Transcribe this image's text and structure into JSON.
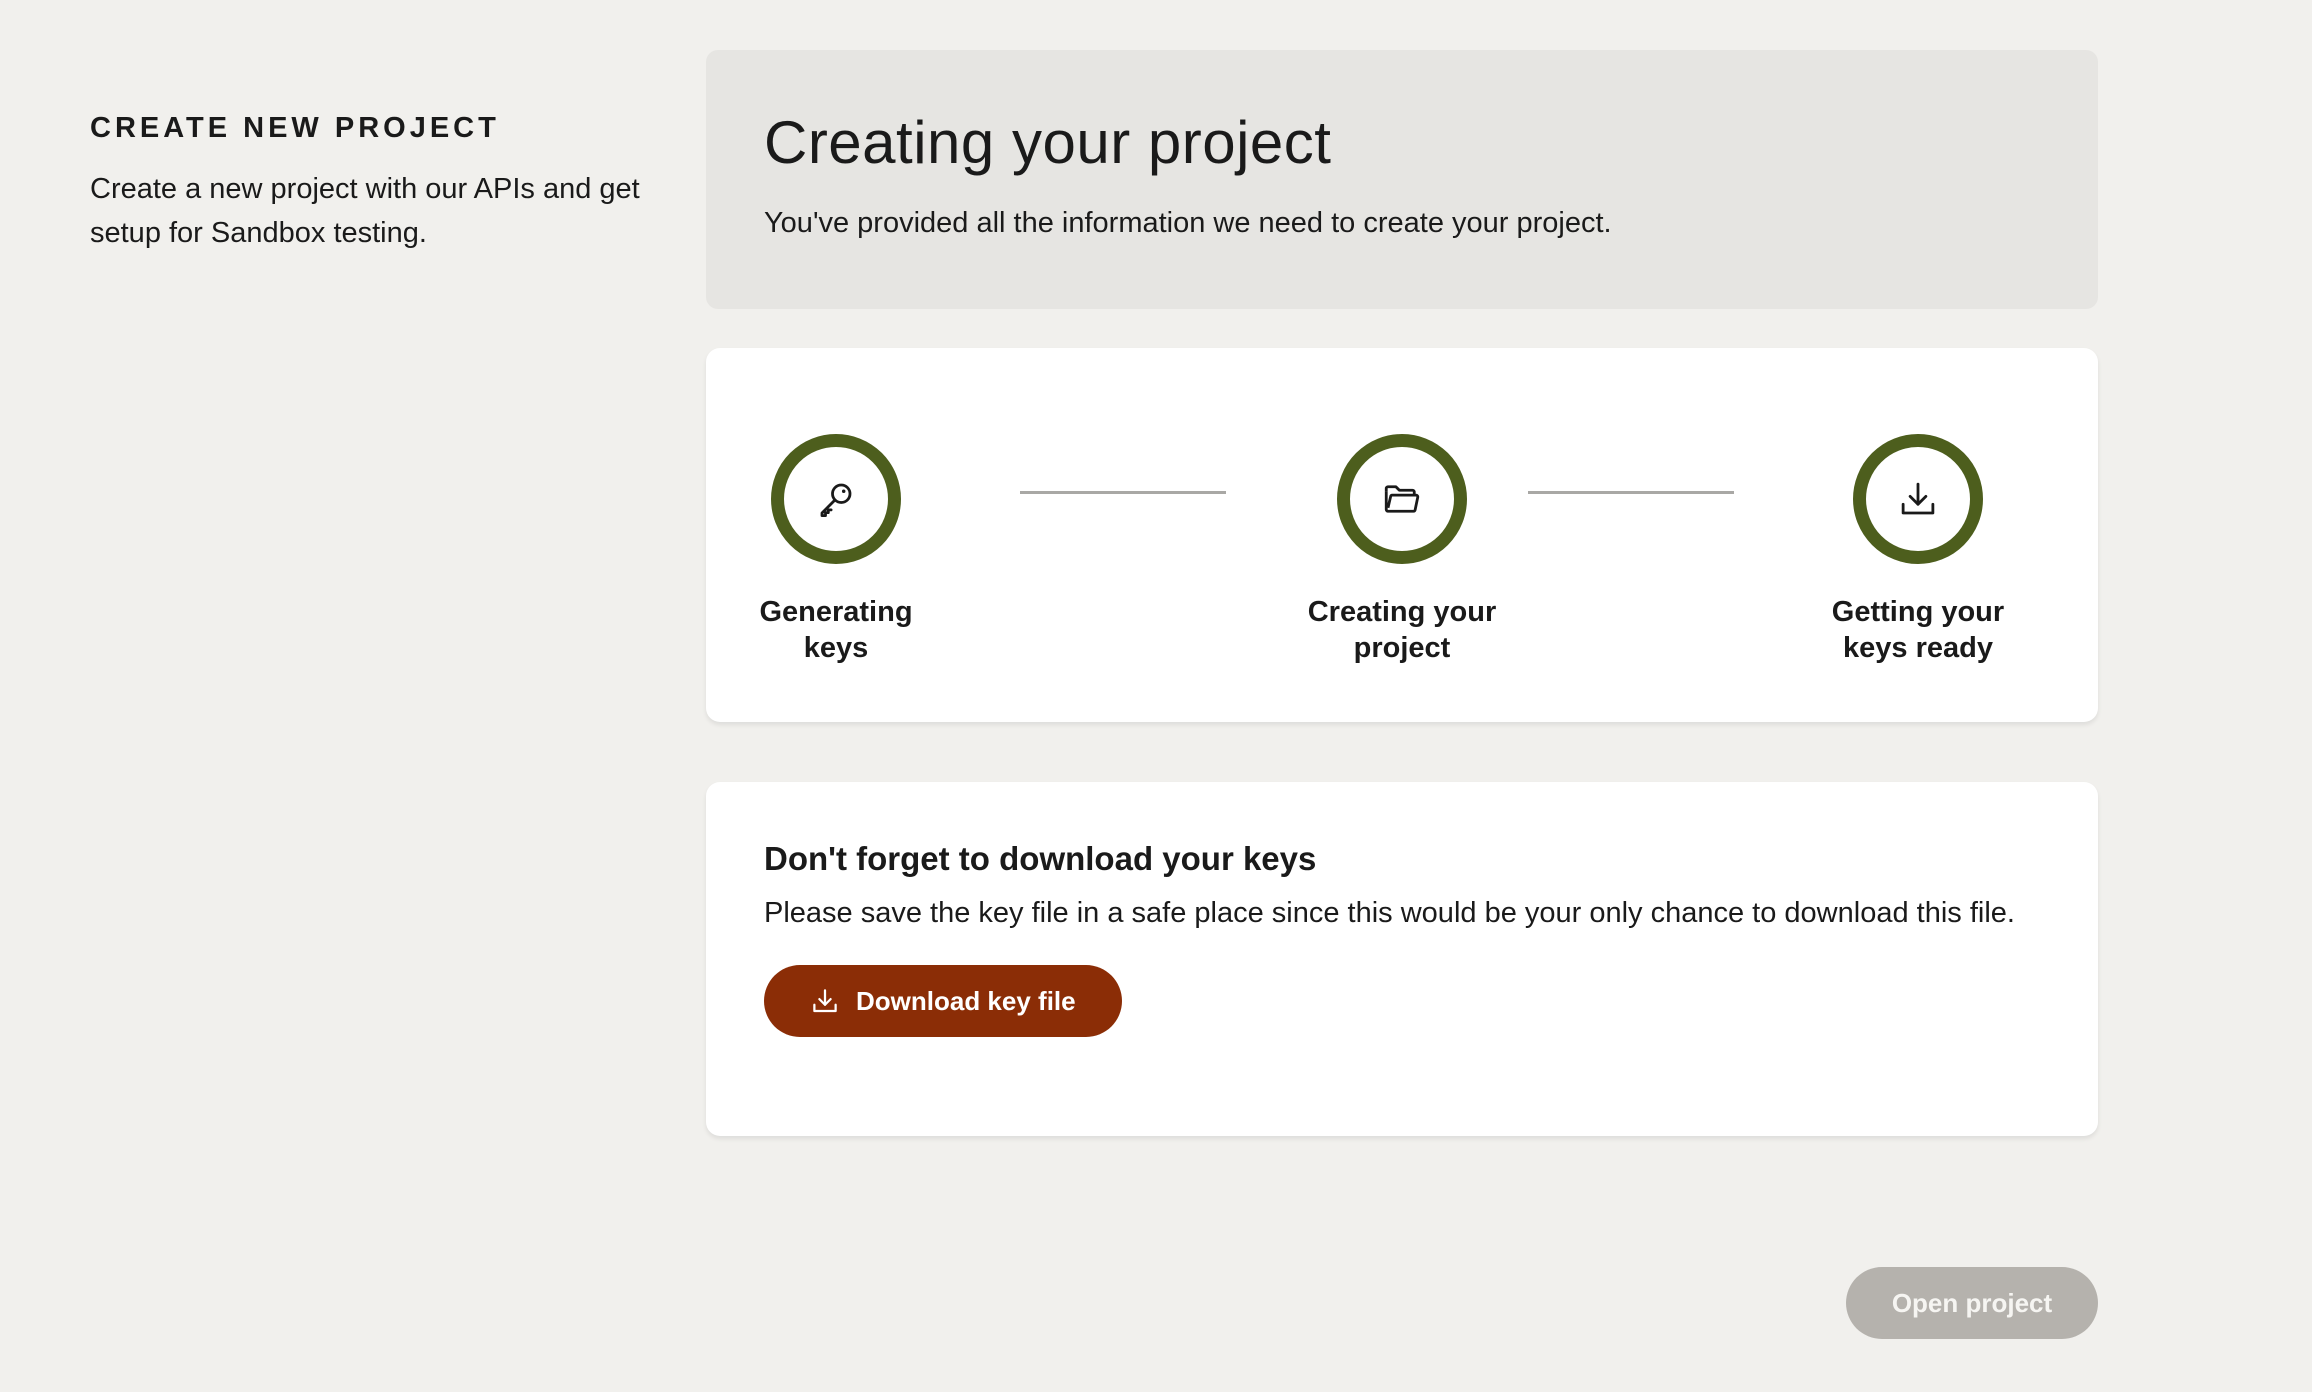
{
  "intro": {
    "title": "CREATE NEW PROJECT",
    "description": "Create a new project with our APIs and get setup for Sandbox testing."
  },
  "header": {
    "title": "Creating your project",
    "subtitle": "You've provided all the information we need to create your project."
  },
  "steps": [
    {
      "label": "Generating keys",
      "icon": "key-icon"
    },
    {
      "label": "Creating your project",
      "icon": "folder-icon"
    },
    {
      "label": "Getting your keys ready",
      "icon": "download-icon"
    }
  ],
  "download": {
    "title": "Don't forget to download your keys",
    "text": "Please save the key file in a safe place since this would be your only chance to download this file.",
    "button_label": "Download key file"
  },
  "actions": {
    "open_project_label": "Open project"
  },
  "colors": {
    "step_ring": "#4d5e1d",
    "primary_button": "#8b2d06",
    "disabled_button": "#b5b2ad",
    "background": "#f1f0ed"
  }
}
